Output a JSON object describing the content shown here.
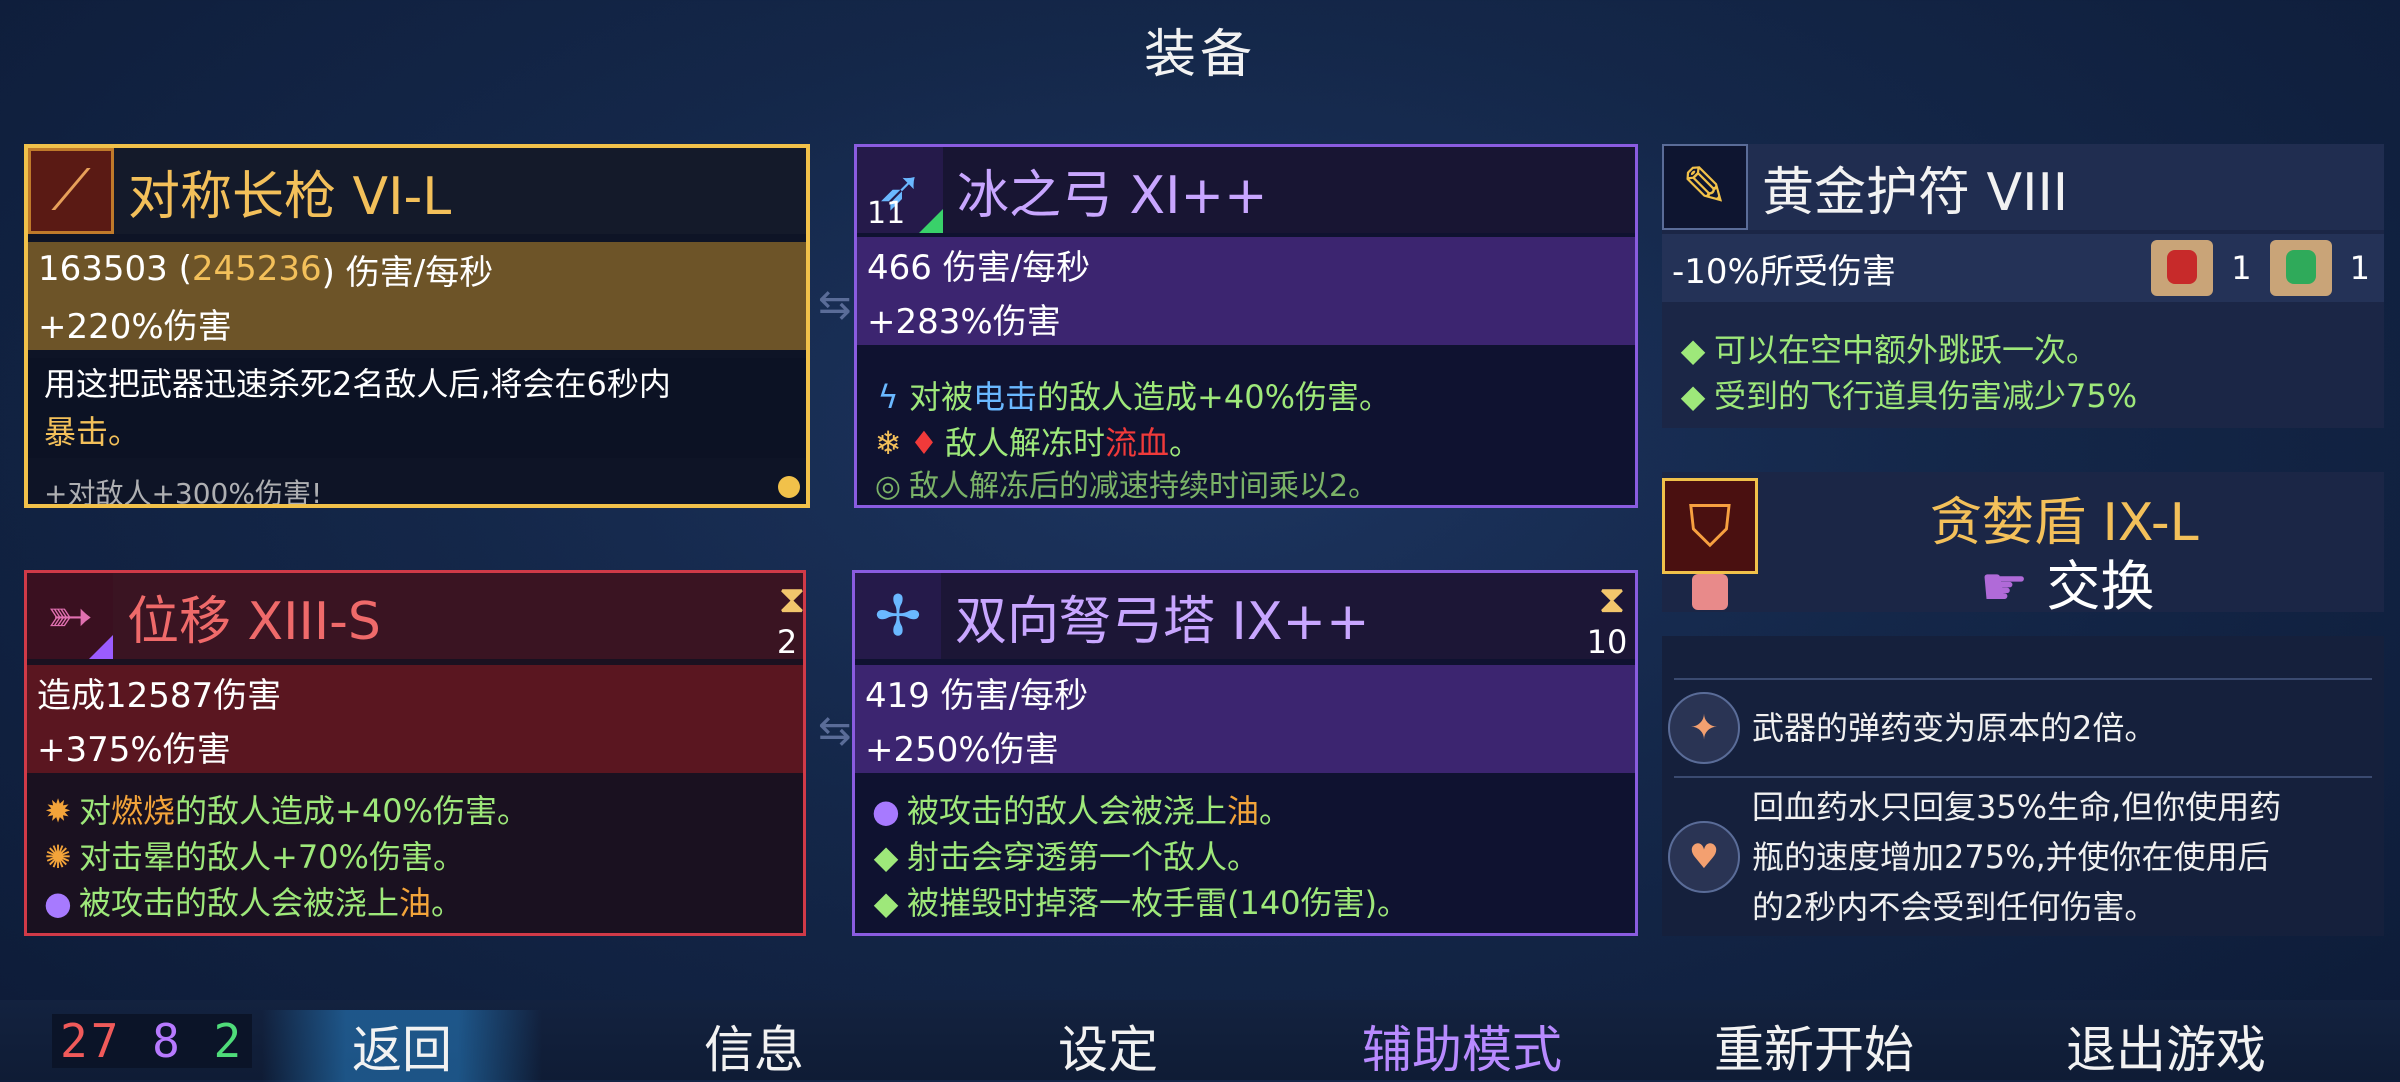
{
  "header": {
    "title": "装备"
  },
  "slot1": {
    "name": "对称长枪 VI-L",
    "dps_base": "163503 (",
    "dps_bonus": "245236",
    "dps_suffix": ") 伤害/每秒",
    "bonus": "+220%伤害",
    "desc1": "用这把武器迅速杀死2名敌人后,将会在6秒内",
    "desc2": "暴击。",
    "desc3": "+对敌人+300%伤害!",
    "icon": "spear-icon"
  },
  "slot2": {
    "name": "冰之弓 XI++",
    "level": "11",
    "dps": "466 伤害/每秒",
    "bonus": "+283%伤害",
    "d1_pre": "对被",
    "d1_hl": "电击",
    "d1_post": "的敌人造成+40%伤害。",
    "d2_pre": "敌人解冻时",
    "d2_hl": "流血",
    "d2_post": "。",
    "d3": "敌人解冻后的减速持续时间乘以2。",
    "icon": "ice-bow-icon"
  },
  "slot3": {
    "name": "黄金护符 VIII",
    "stat": "-10%所受伤害",
    "scroll_red_count": "1",
    "scroll_green_count": "1",
    "d1": "可以在空中额外跳跃一次。",
    "d2": "受到的飞行道具伤害减少75%",
    "icon": "amulet-icon"
  },
  "slot4": {
    "name": "贪婪盾 IX-L",
    "swap_label": "交换",
    "icon": "shield-icon"
  },
  "slot5": {
    "r1": "武器的弹药变为原本的2倍。",
    "r2a": "回血药水只回复35%生命,但你使用药",
    "r2b": "瓶的速度增加275%,并使你在使用后",
    "r2c": "的2秒内不会受到任何伤害。"
  },
  "slot6": {
    "name": "位移 XIII-S",
    "cooldown": "2",
    "damage": "造成12587伤害",
    "bonus": "+375%伤害",
    "d1_pre": "对",
    "d1_hl": "燃烧",
    "d1_post": "的敌人造成+40%伤害。",
    "d2": "对击晕的敌人+70%伤害。",
    "d3_pre": "被攻击的敌人会被浇上",
    "d3_hl": "油",
    "d3_post": "。",
    "icon": "dash-icon"
  },
  "slot7": {
    "name": "双向弩弓塔 IX++",
    "cooldown": "10",
    "dps": "419 伤害/每秒",
    "bonus": "+250%伤害",
    "d1_pre": "被攻击的敌人会被浇上",
    "d1_hl": "油",
    "d1_post": "。",
    "d2": "射击会穿透第一个敌人。",
    "d3": "被摧毁时掉落一枚手雷(140伤害)。",
    "icon": "crossbow-turret-icon"
  },
  "stats": {
    "red": "27",
    "purple": "8",
    "green": "2"
  },
  "colors": {
    "red": "#f05a5a",
    "purple": "#b77aff",
    "green": "#4fdc7a",
    "gold": "#f3c05a"
  },
  "menu": {
    "back": "返回",
    "info": "信息",
    "settings": "设定",
    "assist": "辅助模式",
    "restart": "重新开始",
    "quit": "退出游戏"
  }
}
